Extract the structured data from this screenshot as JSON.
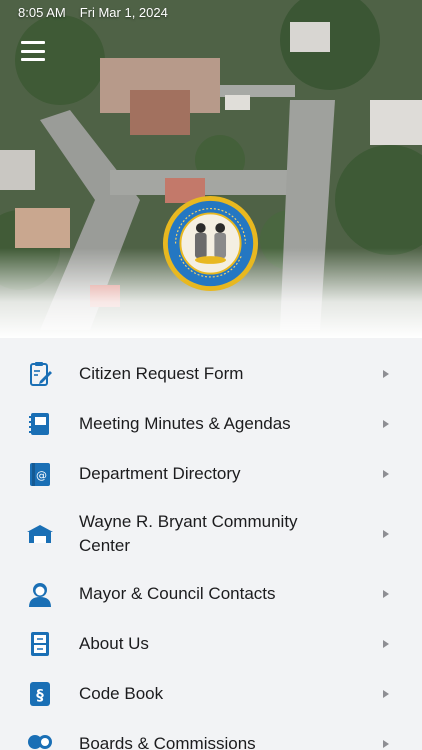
{
  "status_bar": {
    "time": "8:05 AM",
    "date": "Fri Mar 1, 2024"
  },
  "header": {
    "menu_icon": "hamburger-icon",
    "seal": {
      "top_text": "BOROUGH OF LAWNSIDE",
      "bottom_text": "CAMDEN COUNTY"
    }
  },
  "colors": {
    "accent": "#1a6fb5",
    "seal_gold": "#e8b820",
    "seal_blue": "#2477c2",
    "list_bg": "#f2f3f5"
  },
  "menu": {
    "items": [
      {
        "label": "Citizen Request Form",
        "icon": "clipboard-edit-icon"
      },
      {
        "label": "Meeting Minutes & Agendas",
        "icon": "notebook-icon"
      },
      {
        "label": "Department Directory",
        "icon": "address-book-icon"
      },
      {
        "label": "Wayne R. Bryant Community Center",
        "icon": "building-icon"
      },
      {
        "label": "Mayor & Council Contacts",
        "icon": "person-icon"
      },
      {
        "label": "About Us",
        "icon": "file-cabinet-icon"
      },
      {
        "label": "Code Book",
        "icon": "section-book-icon"
      },
      {
        "label": "Boards & Commissions",
        "icon": "group-icon"
      }
    ]
  }
}
